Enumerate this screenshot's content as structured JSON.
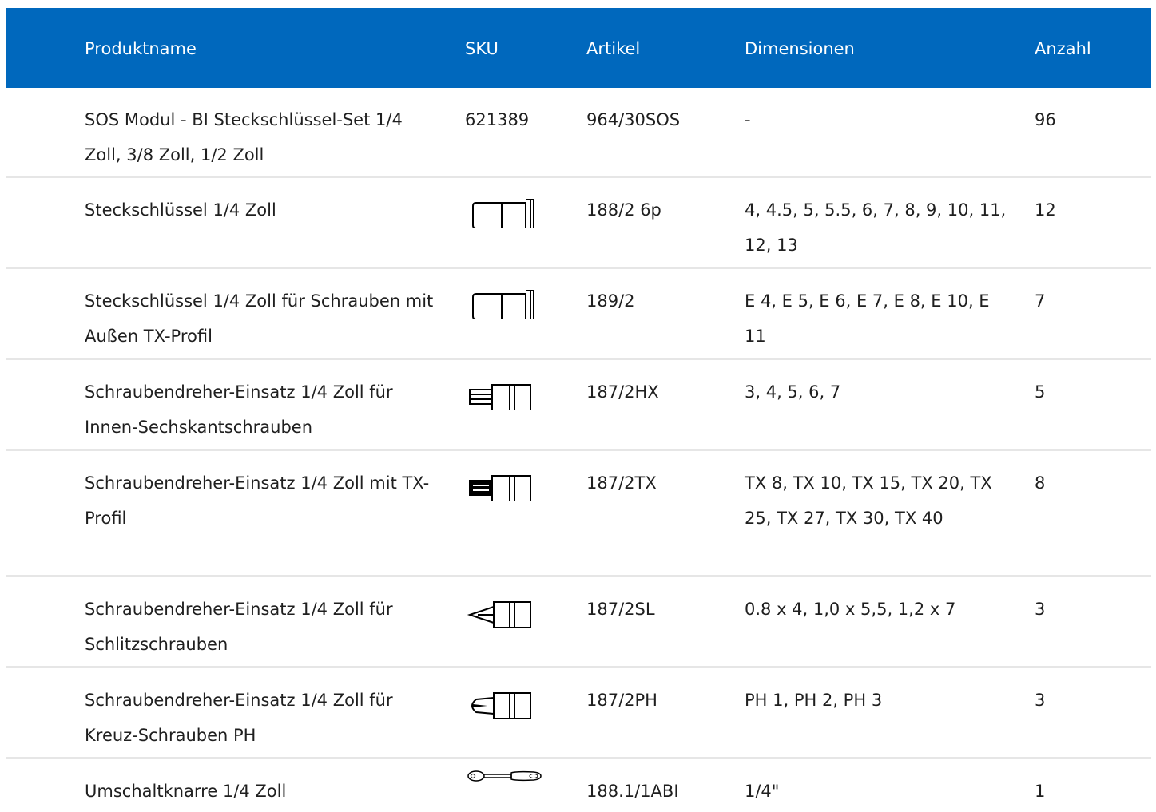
{
  "header": {
    "name": "Produktname",
    "sku": "SKU",
    "article": "Artikel",
    "dimensions": "Dimensionen",
    "quantity": "Anzahl"
  },
  "rows": [
    {
      "name": "SOS Modul - BI Steckschlüssel-Set 1/4 Zoll, 3/8 Zoll, 1/2 Zoll",
      "sku": "621389",
      "icon": "",
      "article": "964/30SOS",
      "dimensions": "-",
      "quantity": "96"
    },
    {
      "name": "Steckschlüssel 1/4 Zoll",
      "sku": "",
      "icon": "socket-icon",
      "article": "188/2 6p",
      "dimensions": "4, 4.5, 5, 5.5, 6, 7, 8, 9, 10, 11, 12, 13",
      "quantity": "12"
    },
    {
      "name": "Steckschlüssel 1/4 Zoll für Schrauben mit Außen TX-Profil",
      "sku": "",
      "icon": "socket-icon",
      "article": "189/2",
      "dimensions": "E 4, E 5, E 6, E 7, E 8, E 10, E 11",
      "quantity": "7"
    },
    {
      "name": "Schraubendreher-Einsatz 1/4 Zoll für Innen-Sechskantschrauben",
      "sku": "",
      "icon": "hex-bit-socket-icon",
      "article": "187/2HX",
      "dimensions": "3, 4, 5, 6, 7",
      "quantity": "5"
    },
    {
      "name": "Schraubendreher-Einsatz 1/4 Zoll mit TX-Profil",
      "sku": "",
      "icon": "tx-bit-socket-icon",
      "article": "187/2TX",
      "dimensions": "TX 8, TX 10, TX 15, TX 20, TX 25, TX 27, TX 30, TX 40",
      "quantity": "8"
    },
    {
      "name": "Schraubendreher-Einsatz 1/4 Zoll für Schlitzschrauben",
      "sku": "",
      "icon": "slotted-bit-socket-icon",
      "article": "187/2SL",
      "dimensions": "0.8 x 4, 1,0 x 5,5, 1,2 x 7",
      "quantity": "3"
    },
    {
      "name": "Schraubendreher-Einsatz 1/4 Zoll für Kreuz-Schrauben PH",
      "sku": "",
      "icon": "phillips-bit-socket-icon",
      "article": "187/2PH",
      "dimensions": "PH 1, PH 2, PH 3",
      "quantity": "3"
    },
    {
      "name": "Umschaltknarre 1/4 Zoll",
      "sku": "",
      "icon": "ratchet-icon",
      "article": "188.1/1ABI",
      "dimensions": "1/4\"",
      "quantity": "1"
    }
  ]
}
